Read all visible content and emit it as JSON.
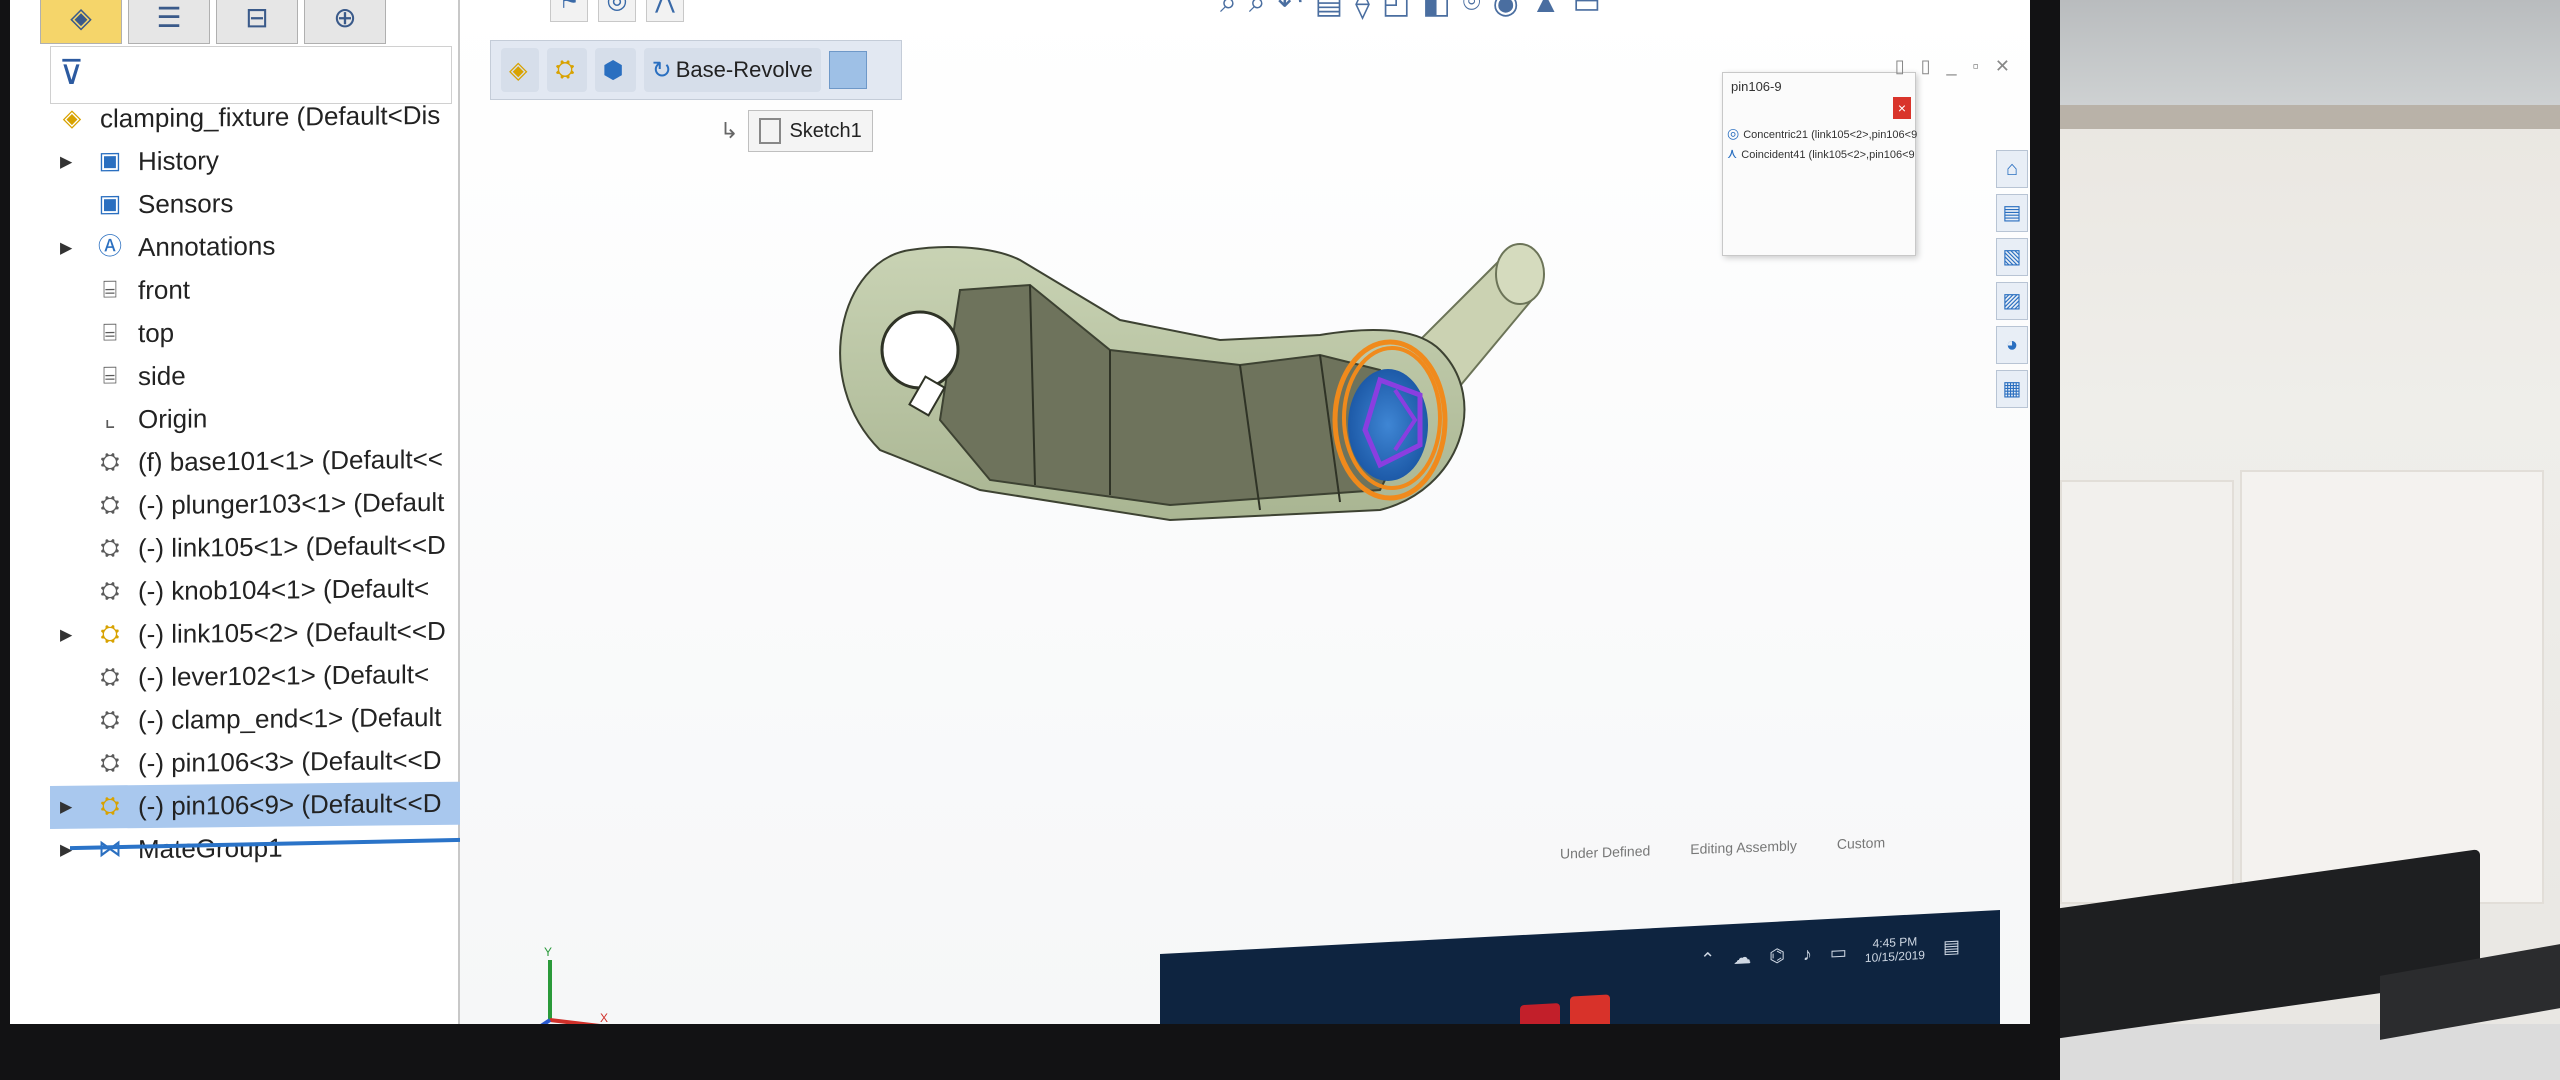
{
  "feature_manager": {
    "tabs": [
      {
        "icon": "assembly-icon"
      },
      {
        "icon": "property-manager-icon"
      },
      {
        "icon": "configuration-manager-icon"
      },
      {
        "icon": "dimxpert-icon"
      }
    ],
    "tree": [
      {
        "label": "clamping_fixture  (Default<Dis",
        "icon": "assembly-icon",
        "type": "root"
      },
      {
        "label": "History",
        "icon": "history-folder-icon",
        "expandable": true
      },
      {
        "label": "Sensors",
        "icon": "sensors-icon"
      },
      {
        "label": "Annotations",
        "icon": "annotations-icon",
        "expandable": true
      },
      {
        "label": "front",
        "icon": "plane-icon"
      },
      {
        "label": "top",
        "icon": "plane-icon"
      },
      {
        "label": "side",
        "icon": "plane-icon"
      },
      {
        "label": "Origin",
        "icon": "origin-icon"
      },
      {
        "label": "(f) base101<1> (Default<<",
        "icon": "part-icon"
      },
      {
        "label": "(-) plunger103<1> (Default",
        "icon": "part-icon"
      },
      {
        "label": "(-) link105<1> (Default<<D",
        "icon": "part-icon"
      },
      {
        "label": "(-) knob104<1> (Default<",
        "icon": "part-icon"
      },
      {
        "label": "(-) link105<2> (Default<<D",
        "icon": "part-yellow-icon",
        "expandable": true
      },
      {
        "label": "(-) lever102<1> (Default<",
        "icon": "part-icon"
      },
      {
        "label": "(-) clamp_end<1> (Default",
        "icon": "part-icon"
      },
      {
        "label": "(-) pin106<3> (Default<<D",
        "icon": "part-icon"
      },
      {
        "label": "(-) pin106<9> (Default<<D",
        "icon": "part-yellow-icon",
        "expandable": true,
        "selected": true
      },
      {
        "label": "MateGroup1",
        "icon": "mates-icon",
        "expandable": true
      }
    ]
  },
  "breadcrumb": {
    "feature_label": "Base-Revolve",
    "sketch_label": "Sketch1"
  },
  "mates_popup": {
    "title": "pin106-9",
    "items": [
      {
        "label": "Concentric21 (link105<2>,pin106<9",
        "icon": "concentric-mate-icon"
      },
      {
        "label": "Coincident41 (link105<2>,pin106<9",
        "icon": "coincident-mate-icon"
      }
    ]
  },
  "status_bar": {
    "definition": "Under Defined",
    "mode": "Editing Assembly",
    "units": "Custom"
  },
  "taskbar": {
    "time": "4:45 PM",
    "date": "10/15/2019"
  },
  "colors": {
    "part_body": "#8c9a78",
    "selection_orange": "#f08a1c",
    "selection_purple": "#8a3ee0",
    "tree_selected": "#a9c8ee",
    "taskbar": "#0e2440"
  }
}
